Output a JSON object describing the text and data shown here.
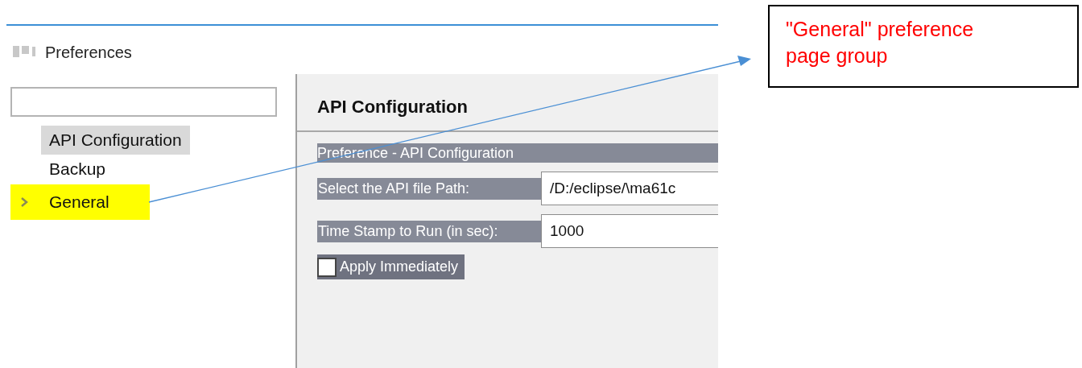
{
  "window": {
    "title": "Preferences"
  },
  "tree": [
    {
      "label": "API Configuration",
      "kind": "leaf",
      "selected": true,
      "highlighted": false
    },
    {
      "label": "Backup",
      "kind": "leaf",
      "selected": false,
      "highlighted": false
    },
    {
      "label": "General",
      "kind": "group",
      "selected": false,
      "highlighted": true
    }
  ],
  "page": {
    "title": "API Configuration",
    "section": "Preference - API Configuration",
    "fields": [
      {
        "label": "Select the API file Path:",
        "value": "/D:/eclipse/\\ma61c"
      },
      {
        "label": "Time Stamp to Run (in sec):",
        "value": "1000"
      }
    ],
    "checkbox": {
      "label": "Apply Immediately",
      "checked": false
    }
  },
  "callout": {
    "text": "\"General\" preference page group"
  }
}
